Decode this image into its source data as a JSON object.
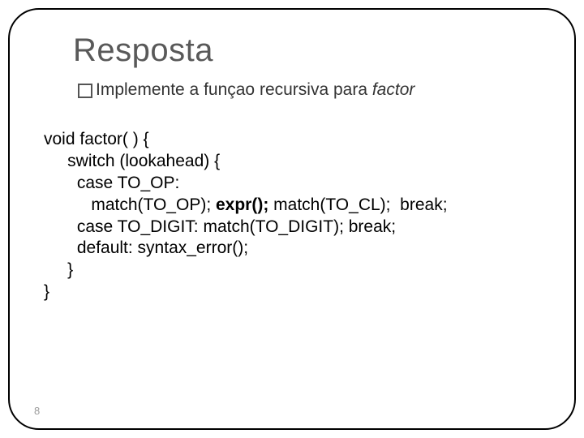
{
  "title": "Resposta",
  "subtitle": {
    "lead": "Implemente a funçao recursiva para ",
    "italic": "factor"
  },
  "code": {
    "l1": "void factor( ) {",
    "l2": "     switch (lookahead) {",
    "l3": "       case TO_OP:",
    "l4a": "          match(TO_OP); ",
    "l4b": "expr();",
    "l4c": " match(TO_CL);  break;",
    "l5": "       case TO_DIGIT: match(TO_DIGIT); break;",
    "l6": "       default: syntax_error();",
    "l7": "     }",
    "l8": "}"
  },
  "page_number": "8"
}
